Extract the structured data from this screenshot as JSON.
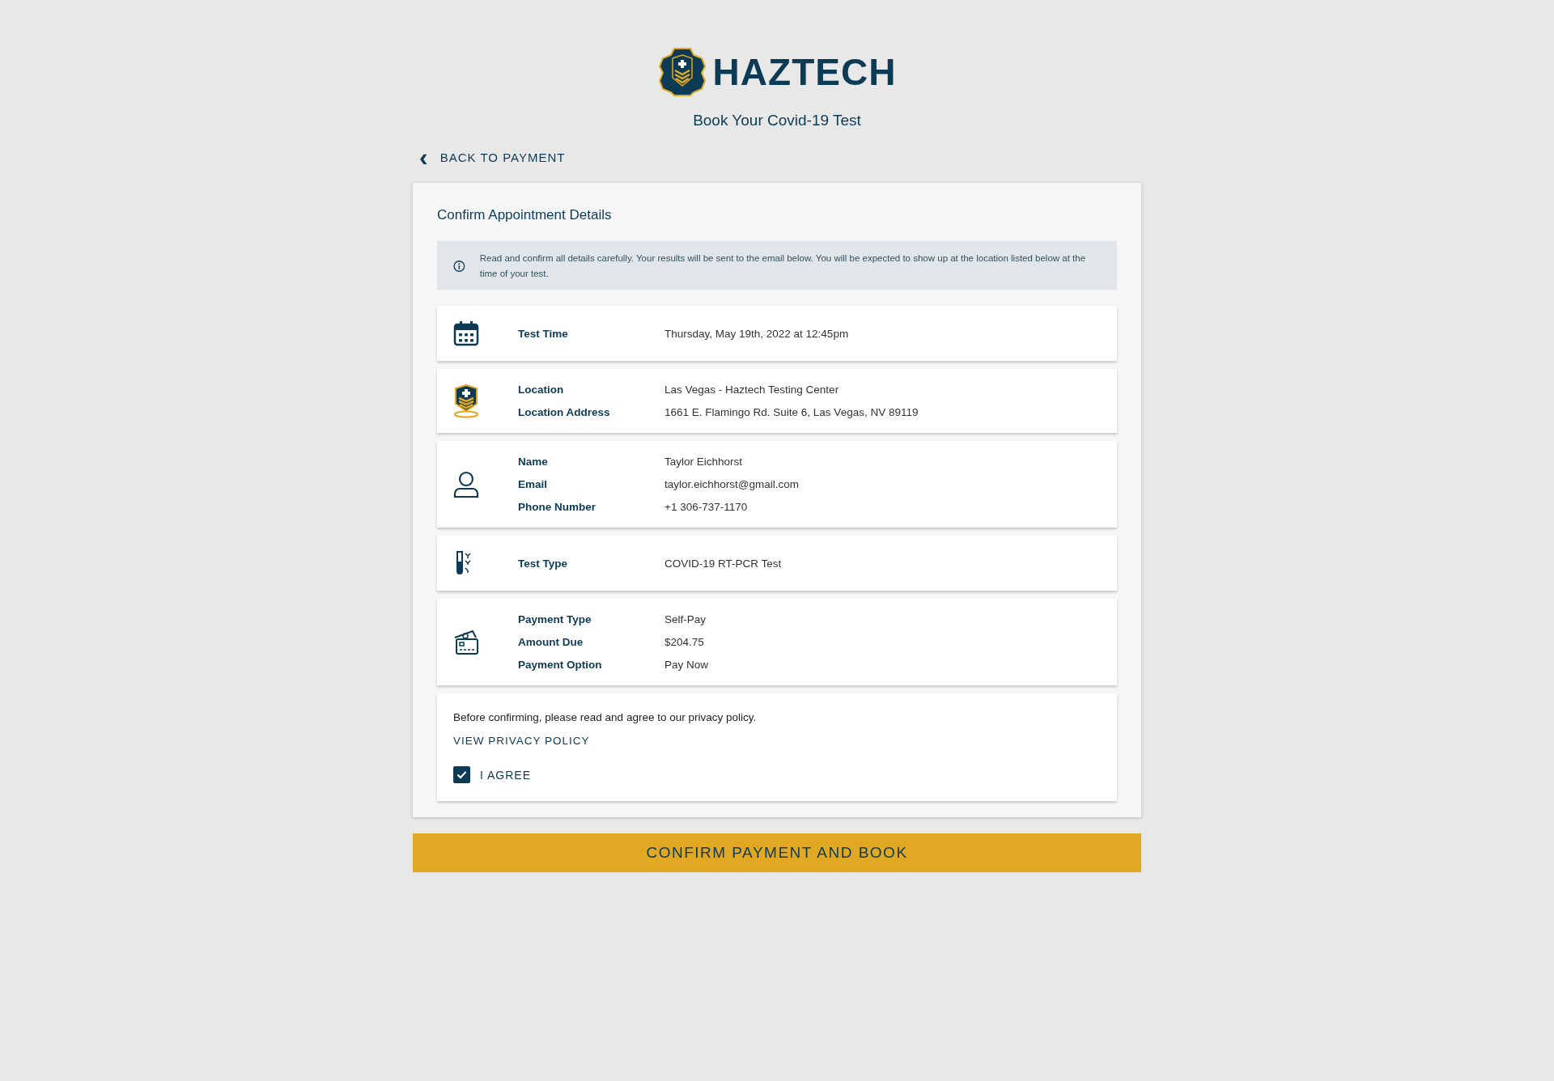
{
  "brand": {
    "name": "HAZTECH"
  },
  "subtitle": "Book Your Covid-19 Test",
  "back_link": {
    "icon": "‹",
    "label": "BACK TO PAYMENT"
  },
  "panel": {
    "title": "Confirm Appointment Details",
    "notice": "Read and confirm all details carefully. Your results will be sent to the email below. You will be expected to show up at the location listed below at the time of your test.",
    "cards": [
      {
        "kind": "calendar",
        "fields": [
          {
            "label": "Test Time",
            "value": "Thursday, May 19th, 2022 at 12:45pm"
          }
        ]
      },
      {
        "kind": "location",
        "fields": [
          {
            "label": "Location",
            "value": "Las Vegas - Haztech Testing Center"
          },
          {
            "label": "Location Address",
            "value": "1661 E. Flamingo Rd. Suite 6, Las Vegas, NV 89119"
          }
        ]
      },
      {
        "kind": "person",
        "fields": [
          {
            "label": "Name",
            "value": "Taylor Eichhorst"
          },
          {
            "label": "Email",
            "value": "taylor.eichhorst@gmail.com"
          },
          {
            "label": "Phone Number",
            "value": "+1 306-737-1170"
          }
        ]
      },
      {
        "kind": "test-tube",
        "fields": [
          {
            "label": "Test Type",
            "value": "COVID-19 RT-PCR Test"
          }
        ]
      },
      {
        "kind": "payment",
        "fields": [
          {
            "label": "Payment Type",
            "value": "Self-Pay"
          },
          {
            "label": "Amount Due",
            "value": "$204.75"
          },
          {
            "label": "Payment Option",
            "value": "Pay Now"
          }
        ]
      }
    ],
    "privacy": {
      "text": "Before confirming, please read and agree to our privacy policy.",
      "link": "VIEW PRIVACY POLICY",
      "agree": {
        "label": "I AGREE",
        "checked": true
      }
    }
  },
  "confirm_button": "CONFIRM PAYMENT AND BOOK"
}
